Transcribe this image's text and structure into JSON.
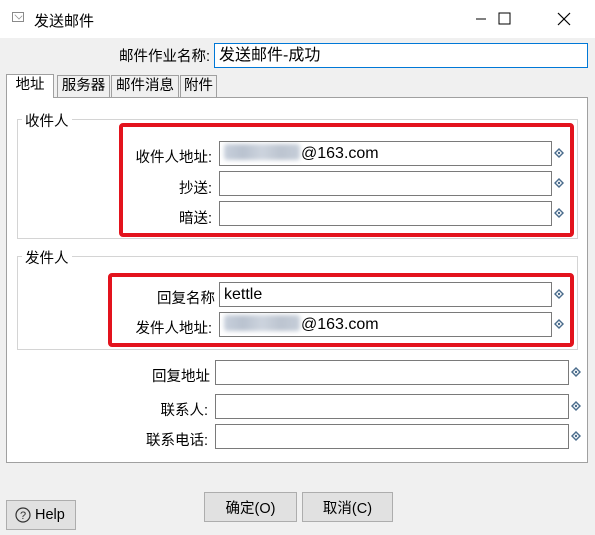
{
  "window": {
    "title": "发送邮件"
  },
  "job_name": {
    "label": "邮件作业名称:",
    "value": "发送邮件-成功"
  },
  "tabs": [
    {
      "label": "地址",
      "active": true
    },
    {
      "label": "服务器",
      "active": false
    },
    {
      "label": "邮件消息",
      "active": false
    },
    {
      "label": "附件",
      "active": false
    }
  ],
  "recipients": {
    "group_title": "收件人",
    "to_label": "收件人地址:",
    "to_value_suffix": "@163.com",
    "cc_label": "抄送:",
    "cc_value": "",
    "bcc_label": "暗送:",
    "bcc_value": ""
  },
  "sender": {
    "group_title": "发件人",
    "reply_name_label": "回复名称",
    "reply_name_value": "kettle",
    "from_label": "发件人地址:",
    "from_value_suffix": "@163.com"
  },
  "extra": {
    "reply_addr_label": "回复地址",
    "reply_addr_value": "",
    "contact_label": "联系人:",
    "contact_value": "",
    "phone_label": "联系电话:",
    "phone_value": ""
  },
  "buttons": {
    "help": "Help",
    "ok": "确定(O)",
    "cancel": "取消(C)"
  },
  "icons": {
    "window": "mail-icon",
    "variable": "variable-diamond-icon",
    "help": "question-icon"
  },
  "colors": {
    "highlight": "#e3131d",
    "focus": "#0078d7",
    "variable_icon": "#4a6c8c"
  }
}
